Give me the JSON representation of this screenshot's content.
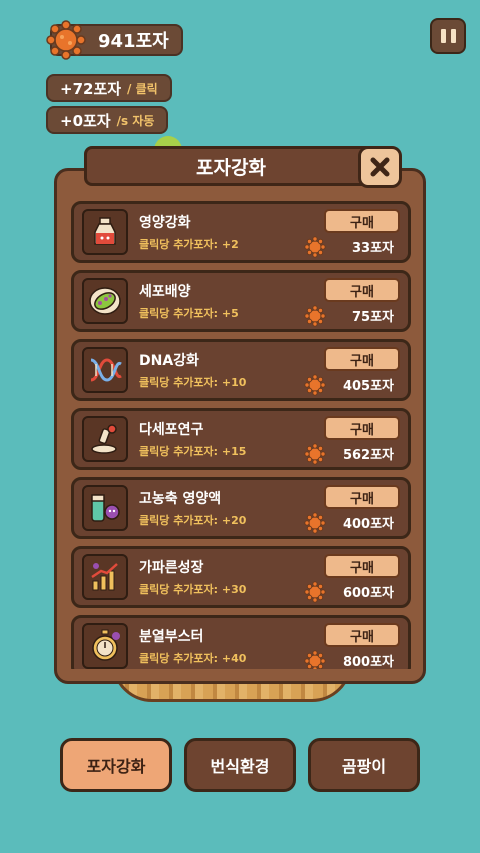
{
  "hud": {
    "spores": "941포자",
    "click_rate": {
      "value": "+72포자",
      "unit": "/ 클릭"
    },
    "auto_rate": {
      "value": "+0포자",
      "unit": "/s 자동"
    }
  },
  "popup": {
    "title": "포자강화",
    "items": [
      {
        "name": "영양강화",
        "desc": "클릭당 추가포자: +2",
        "buy": "구매",
        "price": "33포자",
        "icon": "potion-icon"
      },
      {
        "name": "세포배양",
        "desc": "클릭당 추가포자: +5",
        "buy": "구매",
        "price": "75포자",
        "icon": "petri-dish-icon"
      },
      {
        "name": "DNA강화",
        "desc": "클릭당 추가포자: +10",
        "buy": "구매",
        "price": "405포자",
        "icon": "dna-icon"
      },
      {
        "name": "다세포연구",
        "desc": "클릭당 추가포자: +15",
        "buy": "구매",
        "price": "562포자",
        "icon": "microscope-icon"
      },
      {
        "name": "고농축 영양액",
        "desc": "클릭당 추가포자: +20",
        "buy": "구매",
        "price": "400포자",
        "icon": "nutrient-jar-icon"
      },
      {
        "name": "가파른성장",
        "desc": "클릭당 추가포자: +30",
        "buy": "구매",
        "price": "600포자",
        "icon": "growth-chart-icon"
      },
      {
        "name": "분열부스터",
        "desc": "클릭당 추가포자: +40",
        "buy": "구매",
        "price": "800포자",
        "icon": "stopwatch-icon"
      }
    ]
  },
  "nav": {
    "upgrade": "포자강화",
    "environment": "번식환경",
    "mold": "곰팡이"
  },
  "colors": {
    "background": "#5bbcbb",
    "panel": "#8d5a3c",
    "item": "#6a4230",
    "buy_button": "#eeb98b",
    "accent_text": "#f0c05d",
    "active_nav": "#eea676"
  }
}
